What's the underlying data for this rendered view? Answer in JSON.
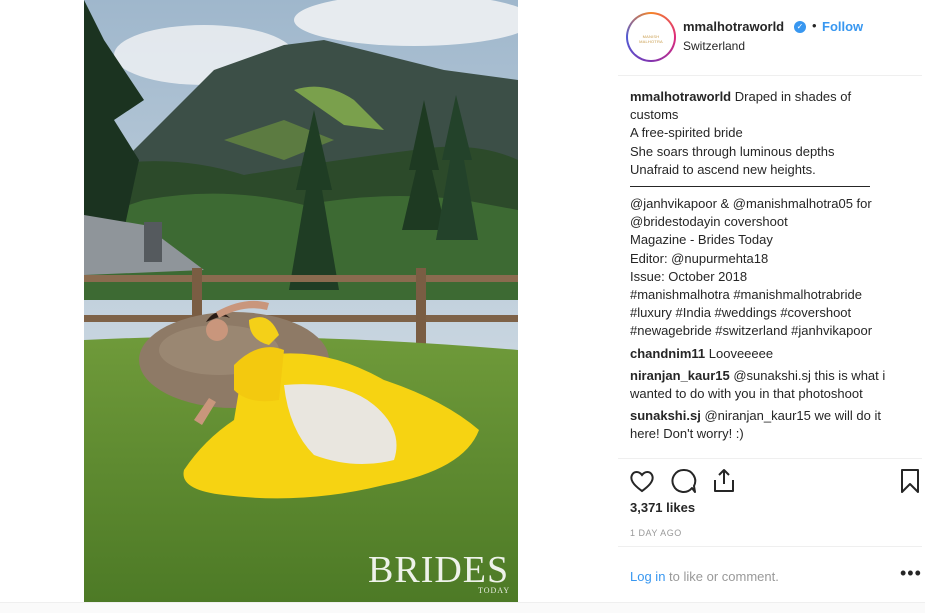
{
  "post": {
    "username": "mmalhotraworld",
    "bullet": "•",
    "follow": "Follow",
    "location": "Switzerland",
    "avatar_text": "MANISH MALHOTRA"
  },
  "photo": {
    "watermark_main": "BRIDES",
    "watermark_sub": "TODAY"
  },
  "caption": {
    "username": "mmalhotraworld",
    "line1": "Draped in shades of",
    "lines": [
      "customs",
      "A free-spirited bride",
      "She soars through luminous depths",
      "Unafraid to ascend new heights."
    ],
    "credits": [
      "@janhvikapoor & @manishmalhotra05 for",
      "@bridestodayin covershoot",
      "Magazine - Brides Today",
      "Editor: @nupurmehta18",
      "Issue: October 2018",
      "#manishmalhotra #manishmalhotrabride",
      "#luxury #India #weddings #covershoot",
      "#newagebride #switzerland #janhvikapoor"
    ]
  },
  "comments": [
    {
      "user": "chandnim11",
      "text": "Looveeeee"
    },
    {
      "user": "niranjan_kaur15",
      "text": "@sunakshi.sj this is what i",
      "text2": "wanted to do with you in that photoshoot"
    },
    {
      "user": "sunakshi.sj",
      "text": "@niranjan_kaur15 we will do it",
      "text2": "here! Don't worry! :)"
    }
  ],
  "likes": "3,371 likes",
  "time": "1 DAY AGO",
  "footer": {
    "login": "Log in",
    "rest": " to like or comment.",
    "more": "•••"
  },
  "icons": [
    "heart-icon",
    "comment-icon",
    "share-icon",
    "bookmark-icon"
  ],
  "colors": {
    "accent": "#3897f0",
    "text": "#262626",
    "muted": "#999999"
  }
}
